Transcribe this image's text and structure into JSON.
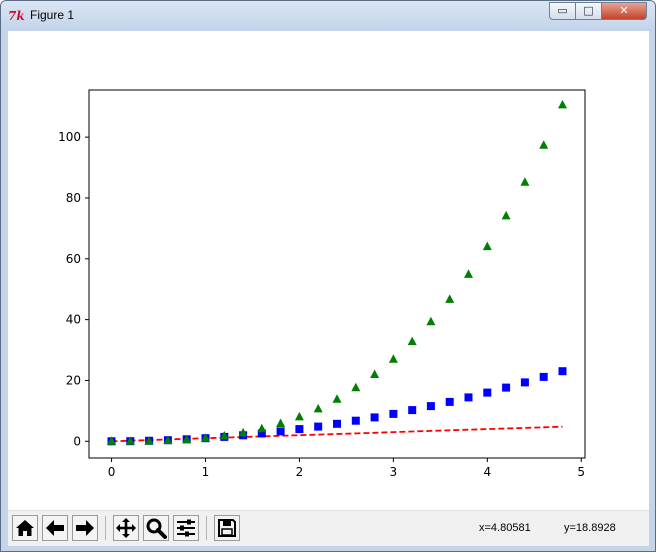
{
  "window": {
    "title": "Figure 1",
    "app_icon_text": "7k",
    "minimize_symbol": "▭",
    "maximize_symbol": "□",
    "close_symbol": "✕"
  },
  "toolbar": {
    "buttons": [
      {
        "name": "home-button",
        "icon": "home-icon"
      },
      {
        "name": "back-button",
        "icon": "arrow-left-icon"
      },
      {
        "name": "forward-button",
        "icon": "arrow-right-icon"
      },
      {
        "name": "pan-button",
        "icon": "move-icon"
      },
      {
        "name": "zoom-button",
        "icon": "magnifier-icon"
      },
      {
        "name": "configure-subplots-button",
        "icon": "sliders-icon"
      },
      {
        "name": "save-button",
        "icon": "floppy-disk-icon"
      }
    ],
    "x_readout": "x=4.80581",
    "y_readout": "y=18.8928"
  },
  "chart_data": {
    "type": "scatter",
    "xlim": [
      -0.24,
      5.04
    ],
    "ylim": [
      -5.5,
      115.5
    ],
    "xticks": [
      0,
      1,
      2,
      3,
      4,
      5
    ],
    "yticks": [
      0,
      20,
      40,
      60,
      80,
      100
    ],
    "grid": false,
    "x": [
      0,
      0.2,
      0.4,
      0.6,
      0.8,
      1.0,
      1.2,
      1.4,
      1.6,
      1.8,
      2.0,
      2.2,
      2.4,
      2.6,
      2.8,
      3.0,
      3.2,
      3.4,
      3.6,
      3.8,
      4.0,
      4.2,
      4.4,
      4.6,
      4.8
    ],
    "series": [
      {
        "style": "red-dashed-line",
        "color": "#ff0000",
        "values": [
          0,
          0.2,
          0.4,
          0.6,
          0.8,
          1.0,
          1.2,
          1.4,
          1.6,
          1.8,
          2.0,
          2.2,
          2.4,
          2.6,
          2.8,
          3.0,
          3.2,
          3.4,
          3.6,
          3.8,
          4.0,
          4.2,
          4.4,
          4.6,
          4.8
        ]
      },
      {
        "style": "blue-squares",
        "color": "#0000ff",
        "values": [
          0,
          0.04,
          0.16,
          0.36,
          0.64,
          1.0,
          1.44,
          1.96,
          2.56,
          3.24,
          4.0,
          4.84,
          5.76,
          6.76,
          7.84,
          9.0,
          10.24,
          11.56,
          12.96,
          14.44,
          16.0,
          17.64,
          19.36,
          21.16,
          23.04
        ]
      },
      {
        "style": "green-triangles",
        "color": "#008000",
        "values": [
          0,
          0.008,
          0.064,
          0.216,
          0.512,
          1.0,
          1.728,
          2.744,
          4.096,
          5.832,
          8.0,
          10.648,
          13.824,
          17.576,
          21.952,
          27.0,
          32.768,
          39.304,
          46.656,
          54.872,
          64.0,
          74.088,
          85.184,
          97.336,
          110.592
        ]
      }
    ]
  }
}
